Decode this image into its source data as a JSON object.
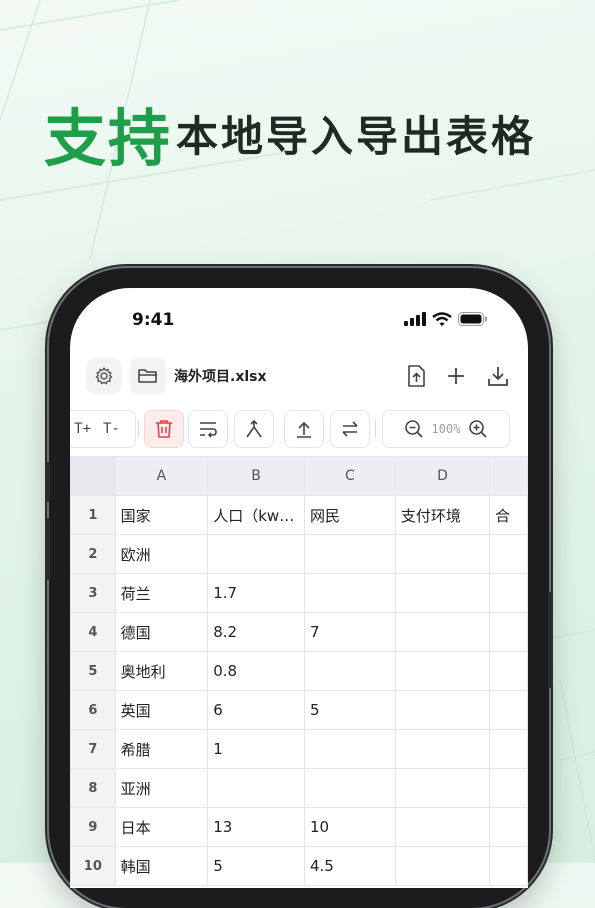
{
  "headline": {
    "accent": "支持",
    "rest": "本地导入导出表格"
  },
  "status_bar": {
    "time": "9:41"
  },
  "titlebar": {
    "file_name": "海外项目.xlsx"
  },
  "toolbar": {
    "font_increase": "T+",
    "font_decrease": "T-",
    "zoom": "100%"
  },
  "sheet": {
    "columns": [
      "A",
      "B",
      "C",
      "D"
    ],
    "rows": [
      {
        "num": "1",
        "cells": [
          "国家",
          "人口（kw…",
          "网民",
          "支付环境",
          "合"
        ]
      },
      {
        "num": "2",
        "cells": [
          "欧洲",
          "",
          "",
          "",
          ""
        ]
      },
      {
        "num": "3",
        "cells": [
          "荷兰",
          "1.7",
          "",
          "",
          ""
        ]
      },
      {
        "num": "4",
        "cells": [
          "德国",
          "8.2",
          "7",
          "",
          ""
        ]
      },
      {
        "num": "5",
        "cells": [
          "奥地利",
          "0.8",
          "",
          "",
          ""
        ]
      },
      {
        "num": "6",
        "cells": [
          "英国",
          "6",
          "5",
          "",
          ""
        ]
      },
      {
        "num": "7",
        "cells": [
          "希腊",
          "1",
          "",
          "",
          ""
        ]
      },
      {
        "num": "8",
        "cells": [
          "亚洲",
          "",
          "",
          "",
          ""
        ]
      },
      {
        "num": "9",
        "cells": [
          "日本",
          "13",
          "10",
          "",
          ""
        ]
      },
      {
        "num": "10",
        "cells": [
          "韩国",
          "5",
          "4.5",
          "",
          ""
        ]
      }
    ]
  },
  "colors": {
    "accent": "#1f9e4a",
    "delete": "#e04545"
  }
}
